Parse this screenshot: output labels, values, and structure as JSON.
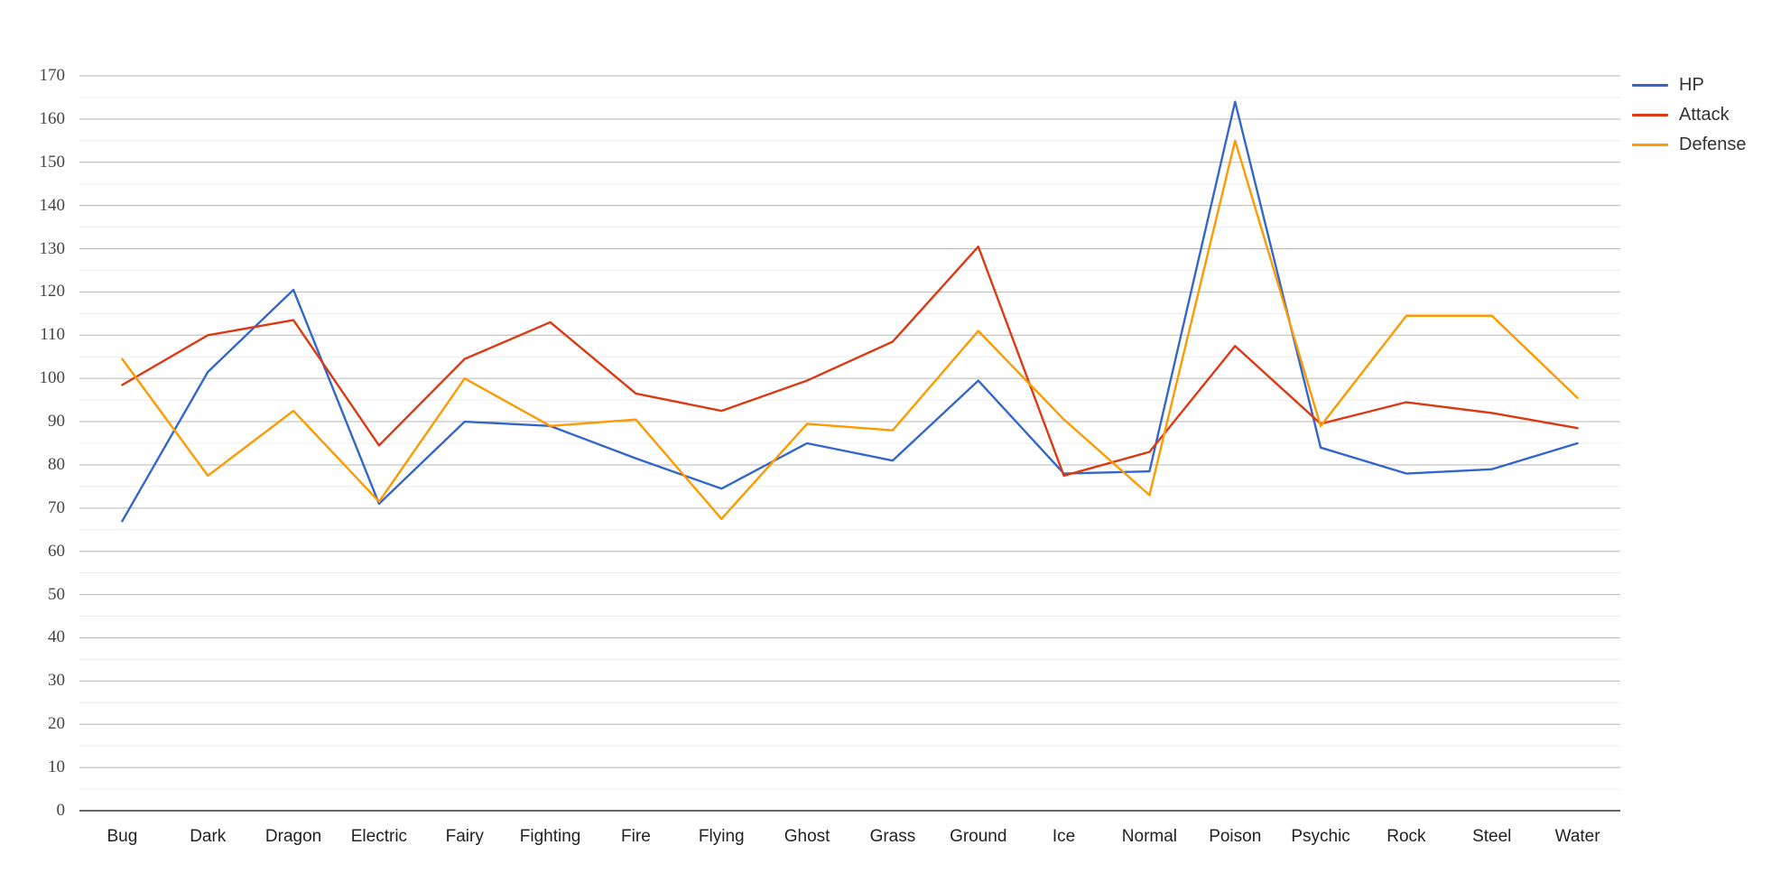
{
  "chart_data": {
    "type": "line",
    "title": "",
    "xlabel": "",
    "ylabel": "",
    "ylim": [
      0,
      170
    ],
    "y_ticks": [
      0,
      10,
      20,
      30,
      40,
      50,
      60,
      70,
      80,
      90,
      100,
      110,
      120,
      130,
      140,
      150,
      160,
      170
    ],
    "y_minor_gridlines": true,
    "grid": true,
    "legend_position": "right",
    "categories": [
      "Bug",
      "Dark",
      "Dragon",
      "Electric",
      "Fairy",
      "Fighting",
      "Fire",
      "Flying",
      "Ghost",
      "Grass",
      "Ground",
      "Ice",
      "Normal",
      "Poison",
      "Psychic",
      "Rock",
      "Steel",
      "Water"
    ],
    "series": [
      {
        "name": "HP",
        "color": "#3366cc",
        "values": [
          67,
          101.5,
          120.5,
          71,
          90,
          89,
          81.5,
          74.5,
          85,
          81,
          99.5,
          78,
          78.5,
          164,
          84,
          78,
          79,
          85
        ]
      },
      {
        "name": "Attack",
        "color": "#dc3912",
        "values": [
          98.5,
          110,
          113.5,
          84.5,
          104.5,
          113,
          96.5,
          92.5,
          99.5,
          108.5,
          130.5,
          77.5,
          83,
          107.5,
          89.5,
          94.5,
          92,
          88.5
        ]
      },
      {
        "name": "Defense",
        "color": "#ff9900",
        "values": [
          104.5,
          77.5,
          92.5,
          71.5,
          100,
          89,
          90.5,
          67.5,
          89.5,
          88,
          111,
          90.5,
          73,
          155,
          89,
          114.5,
          114.5,
          95.5
        ]
      }
    ]
  },
  "legend": {
    "items": [
      {
        "label": "HP",
        "color": "#3366cc"
      },
      {
        "label": "Attack",
        "color": "#dc3912"
      },
      {
        "label": "Defense",
        "color": "#ff9900"
      }
    ]
  },
  "axis": {
    "y_tick_labels": [
      "170",
      "160",
      "150",
      "140",
      "130",
      "120",
      "110",
      "100",
      "90",
      "80",
      "70",
      "60",
      "50",
      "40",
      "30",
      "20",
      "10",
      "0"
    ],
    "x_tick_labels": [
      "Bug",
      "Dark",
      "Dragon",
      "Electric",
      "Fairy",
      "Fighting",
      "Fire",
      "Flying",
      "Ghost",
      "Grass",
      "Ground",
      "Ice",
      "Normal",
      "Poison",
      "Psychic",
      "Rock",
      "Steel",
      "Water"
    ]
  },
  "colors": {
    "background": "#ffffff",
    "gridline_major": "#b7b7b7",
    "gridline_minor": "#ececec",
    "axis_line": "#333333",
    "tick_text": "#444444"
  }
}
